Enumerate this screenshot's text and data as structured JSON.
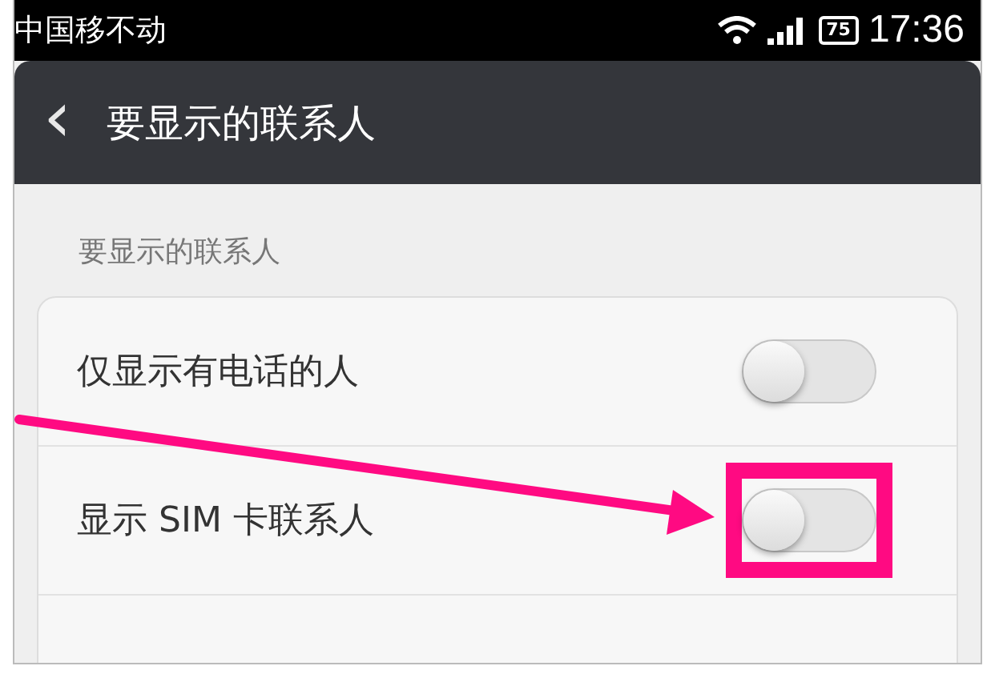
{
  "status_bar": {
    "carrier": "中国移不动",
    "battery": "75",
    "time": "17:36"
  },
  "header": {
    "back": "‹",
    "title": "要显示的联系人"
  },
  "section": {
    "label": "要显示的联系人"
  },
  "rows": [
    {
      "label": "仅显示有电话的人",
      "on": false,
      "annotated": false
    },
    {
      "label": "显示 SIM 卡联系人",
      "on": false,
      "annotated": true
    }
  ]
}
